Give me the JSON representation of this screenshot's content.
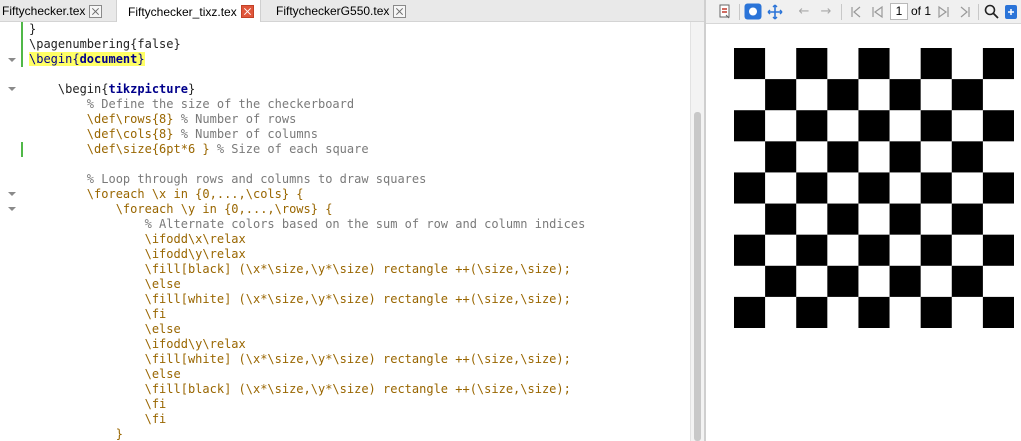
{
  "tabs": [
    {
      "label": "Fiftychecker.tex",
      "close": "close-icon",
      "active": false
    },
    {
      "label": "Fiftychecker_tixz.tex",
      "close": "close-icon-red",
      "active": true
    },
    {
      "label": "FiftycheckerG550.tex",
      "close": "close-icon",
      "active": false
    }
  ],
  "editor": {
    "lines": [
      [
        {
          "t": "}",
          "c": "plain"
        }
      ],
      [
        {
          "t": "\\pagenumbering{false}",
          "c": "plain"
        }
      ],
      [
        {
          "t": "\\begin{",
          "c": "begin"
        },
        {
          "t": "document",
          "c": "hl"
        },
        {
          "t": "}",
          "c": "begin"
        }
      ],
      [
        {
          "t": "",
          "c": "plain"
        }
      ],
      [
        {
          "t": "    \\begin{",
          "c": "plain"
        },
        {
          "t": "tikzpicture",
          "c": "bold"
        },
        {
          "t": "}",
          "c": "plain"
        }
      ],
      [
        {
          "t": "        % Define the size of the checkerboard",
          "c": "cmt"
        }
      ],
      [
        {
          "t": "        \\def\\rows{8} ",
          "c": "cmd"
        },
        {
          "t": "% Number of rows",
          "c": "cmt"
        }
      ],
      [
        {
          "t": "        \\def\\cols{8} ",
          "c": "cmd"
        },
        {
          "t": "% Number of columns",
          "c": "cmt"
        }
      ],
      [
        {
          "t": "        \\def\\size{6pt*6 } ",
          "c": "cmd"
        },
        {
          "t": "% Size of each square",
          "c": "cmt"
        }
      ],
      [
        {
          "t": "",
          "c": "plain"
        }
      ],
      [
        {
          "t": "        % Loop through rows and columns to draw squares",
          "c": "cmt"
        }
      ],
      [
        {
          "t": "        \\foreach \\x in {0,...,\\cols} {",
          "c": "cmd"
        }
      ],
      [
        {
          "t": "            \\foreach \\y in {0,...,\\rows} {",
          "c": "cmd"
        }
      ],
      [
        {
          "t": "                % Alternate colors based on the sum of row and column indices",
          "c": "cmt"
        }
      ],
      [
        {
          "t": "                \\ifodd\\x\\relax",
          "c": "cmd"
        }
      ],
      [
        {
          "t": "                \\ifodd\\y\\relax",
          "c": "cmd"
        }
      ],
      [
        {
          "t": "                \\fill[black] (\\x*\\size,\\y*\\size) rectangle ++(\\size,\\size);",
          "c": "cmd"
        }
      ],
      [
        {
          "t": "                \\else",
          "c": "cmd"
        }
      ],
      [
        {
          "t": "                \\fill[white] (\\x*\\size,\\y*\\size) rectangle ++(\\size,\\size);",
          "c": "cmd"
        }
      ],
      [
        {
          "t": "                \\fi",
          "c": "cmd"
        }
      ],
      [
        {
          "t": "                \\else",
          "c": "cmd"
        }
      ],
      [
        {
          "t": "                \\ifodd\\y\\relax",
          "c": "cmd"
        }
      ],
      [
        {
          "t": "                \\fill[white] (\\x*\\size,\\y*\\size) rectangle ++(\\size,\\size);",
          "c": "cmd"
        }
      ],
      [
        {
          "t": "                \\else",
          "c": "cmd"
        }
      ],
      [
        {
          "t": "                \\fill[black] (\\x*\\size,\\y*\\size) rectangle ++(\\size,\\size);",
          "c": "cmd"
        }
      ],
      [
        {
          "t": "                \\fi",
          "c": "cmd"
        }
      ],
      [
        {
          "t": "                \\fi",
          "c": "cmd"
        }
      ],
      [
        {
          "t": "            }",
          "c": "cmd"
        }
      ]
    ]
  },
  "viewer": {
    "toolbar": {
      "sync_icon": "sync-source-icon",
      "select_icon": "select-mode-icon",
      "pan_icon": "pan-tool-icon",
      "back_icon": "back-arrow-icon",
      "forward_icon": "forward-arrow-icon",
      "first_icon": "first-page-icon",
      "prev_icon": "previous-page-icon",
      "page_input": "1",
      "of_pages": "of 1",
      "next_icon": "next-page-icon",
      "last_icon": "last-page-icon",
      "search_icon": "search-icon",
      "export_icon": "export-icon"
    },
    "checkerboard": {
      "rows": 9,
      "cols": 9,
      "colors": {
        "dark": "#000000",
        "light": "#ffffff"
      }
    }
  },
  "colors": {
    "command": "#996600",
    "comment": "#7a7a7a",
    "environment": "#00008b",
    "highlight": "#ffff66",
    "change_marker": "#50b848",
    "accent": "#2b74d8"
  }
}
